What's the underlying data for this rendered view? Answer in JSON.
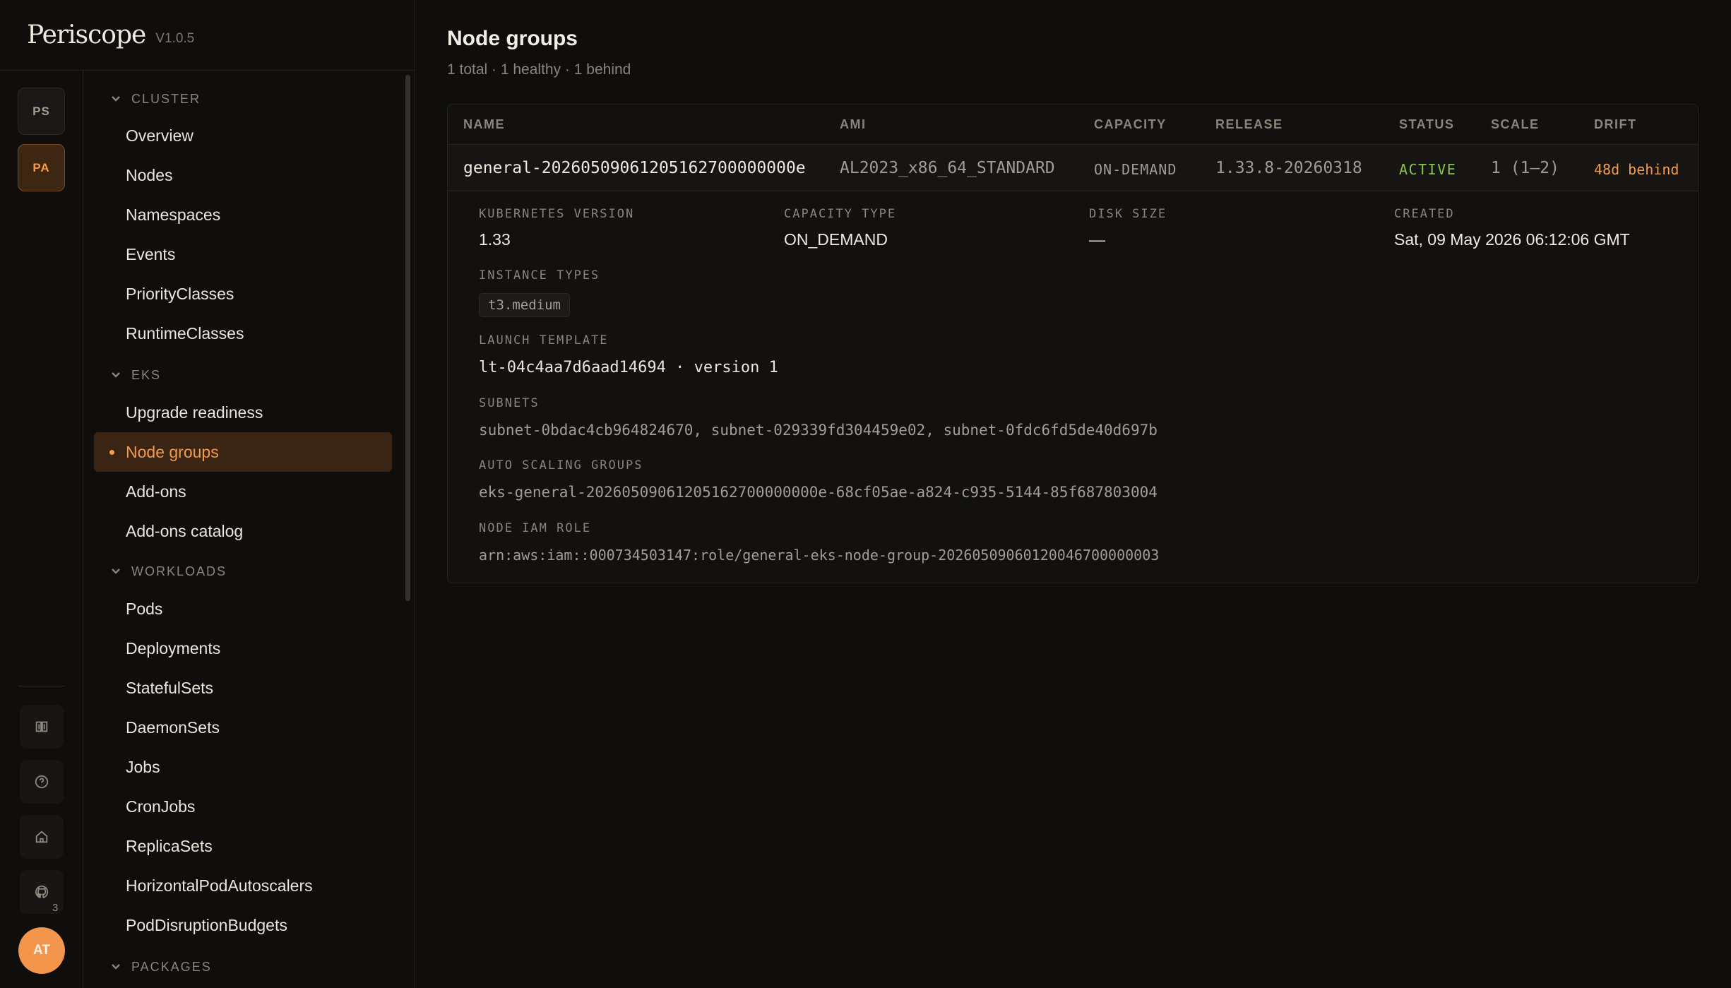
{
  "app": {
    "name": "Periscope",
    "version": "V1.0.5"
  },
  "rail": {
    "contexts": [
      "PS",
      "PA"
    ],
    "icons": [
      "book-icon",
      "help-icon",
      "home-icon",
      "github-icon"
    ],
    "badge": "3",
    "avatar": "AT"
  },
  "sidebar": {
    "sections": [
      {
        "label": "CLUSTER",
        "items": [
          "Overview",
          "Nodes",
          "Namespaces",
          "Events",
          "PriorityClasses",
          "RuntimeClasses"
        ]
      },
      {
        "label": "EKS",
        "items": [
          "Upgrade readiness",
          "Node groups",
          "Add-ons",
          "Add-ons catalog"
        ]
      },
      {
        "label": "WORKLOADS",
        "items": [
          "Pods",
          "Deployments",
          "StatefulSets",
          "DaemonSets",
          "Jobs",
          "CronJobs",
          "ReplicaSets",
          "HorizontalPodAutoscalers",
          "PodDisruptionBudgets"
        ]
      },
      {
        "label": "PACKAGES",
        "items": []
      }
    ],
    "active_item": "Node groups"
  },
  "page": {
    "title": "Node groups",
    "summary": "1 total · 1 healthy · 1 behind"
  },
  "table": {
    "columns": [
      "NAME",
      "AMI",
      "CAPACITY",
      "RELEASE",
      "STATUS",
      "SCALE",
      "DRIFT"
    ],
    "rows": [
      {
        "name": "general-20260509061205162700000000e",
        "ami": "AL2023_x86_64_STANDARD",
        "capacity": "ON-DEMAND",
        "release": "1.33.8-20260318",
        "status": "ACTIVE",
        "scale": "1 (1–2)",
        "drift": "48d behind"
      }
    ]
  },
  "detail": {
    "kubernetes_version_label": "KUBERNETES VERSION",
    "kubernetes_version": "1.33",
    "capacity_type_label": "CAPACITY TYPE",
    "capacity_type": "ON_DEMAND",
    "disk_size_label": "DISK SIZE",
    "disk_size": "—",
    "created_label": "CREATED",
    "created": "Sat, 09 May 2026 06:12:06 GMT",
    "instance_types_label": "INSTANCE TYPES",
    "instance_types": [
      "t3.medium"
    ],
    "launch_template_label": "LAUNCH TEMPLATE",
    "launch_template": "lt-04c4aa7d6aad14694 · version 1",
    "subnets_label": "SUBNETS",
    "subnets": "subnet-0bdac4cb964824670, subnet-029339fd304459e02, subnet-0fdc6fd5de40d697b",
    "asg_label": "AUTO SCALING GROUPS",
    "asg": "eks-general-20260509061205162700000000e-68cf05ae-a824-c935-5144-85f687803004",
    "iam_role_label": "NODE IAM ROLE",
    "iam_role": "arn:aws:iam::000734503147:role/general-eks-node-group-20260509060120046700000003"
  },
  "colors": {
    "accent": "#f39b4b",
    "status_active": "#8bc34a",
    "background": "#0f0e0d"
  }
}
